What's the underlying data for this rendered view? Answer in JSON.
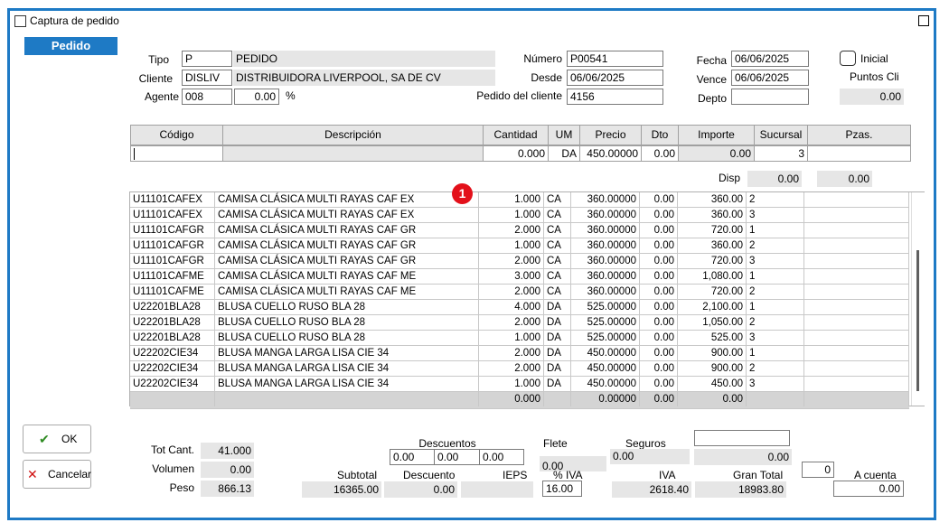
{
  "window": {
    "title": "Captura de pedido"
  },
  "section_tab": "Pedido",
  "header": {
    "tipo_label": "Tipo",
    "tipo_code": "P",
    "tipo_desc": "PEDIDO",
    "cliente_label": "Cliente",
    "cliente_code": "DISLIV",
    "cliente_name": "DISTRIBUIDORA LIVERPOOL, SA DE CV",
    "agente_label": "Agente",
    "agente_code": "008",
    "agente_pct": "0.00",
    "pct_symbol": "%",
    "numero_label": "Número",
    "numero": "P00541",
    "desde_label": "Desde",
    "desde": "06/06/2025",
    "pedido_cliente_label": "Pedido del cliente",
    "pedido_cliente": "4156",
    "fecha_label": "Fecha",
    "fecha": "06/06/2025",
    "vence_label": "Vence",
    "vence": "06/06/2025",
    "depto_label": "Depto",
    "depto": "",
    "inicial_label": "Inicial",
    "puntos_label": "Puntos Cli",
    "puntos": "0.00"
  },
  "entry": {
    "columns": [
      "Código",
      "Descripción",
      "Cantidad",
      "UM",
      "Precio",
      "Dto",
      "Importe",
      "Sucursal",
      "Pzas."
    ],
    "codigo": "",
    "descripcion": "",
    "cantidad": "0.000",
    "um": "DA",
    "precio": "450.00000",
    "dto": "0.00",
    "importe": "0.00",
    "sucursal": "3",
    "pzas": "",
    "disp_label": "Disp",
    "disp1": "0.00",
    "disp2": "0.00"
  },
  "badge": "1",
  "rows": [
    {
      "codigo": "U11101CAFEX",
      "desc": "CAMISA CLÁSICA MULTI RAYAS CAF EX",
      "cant": "1.000",
      "um": "CA",
      "precio": "360.00000",
      "dto": "0.00",
      "importe": "360.00",
      "suc": "2"
    },
    {
      "codigo": "U11101CAFEX",
      "desc": "CAMISA CLÁSICA MULTI RAYAS CAF EX",
      "cant": "1.000",
      "um": "CA",
      "precio": "360.00000",
      "dto": "0.00",
      "importe": "360.00",
      "suc": "3"
    },
    {
      "codigo": "U11101CAFGR",
      "desc": "CAMISA CLÁSICA MULTI RAYAS CAF GR",
      "cant": "2.000",
      "um": "CA",
      "precio": "360.00000",
      "dto": "0.00",
      "importe": "720.00",
      "suc": "1"
    },
    {
      "codigo": "U11101CAFGR",
      "desc": "CAMISA CLÁSICA MULTI RAYAS CAF GR",
      "cant": "1.000",
      "um": "CA",
      "precio": "360.00000",
      "dto": "0.00",
      "importe": "360.00",
      "suc": "2"
    },
    {
      "codigo": "U11101CAFGR",
      "desc": "CAMISA CLÁSICA MULTI RAYAS CAF GR",
      "cant": "2.000",
      "um": "CA",
      "precio": "360.00000",
      "dto": "0.00",
      "importe": "720.00",
      "suc": "3"
    },
    {
      "codigo": "U11101CAFME",
      "desc": "CAMISA CLÁSICA MULTI RAYAS CAF ME",
      "cant": "3.000",
      "um": "CA",
      "precio": "360.00000",
      "dto": "0.00",
      "importe": "1,080.00",
      "suc": "1"
    },
    {
      "codigo": "U11101CAFME",
      "desc": "CAMISA CLÁSICA MULTI RAYAS CAF ME",
      "cant": "2.000",
      "um": "CA",
      "precio": "360.00000",
      "dto": "0.00",
      "importe": "720.00",
      "suc": "2"
    },
    {
      "codigo": "U22201BLA28",
      "desc": "BLUSA CUELLO RUSO BLA 28",
      "cant": "4.000",
      "um": "DA",
      "precio": "525.00000",
      "dto": "0.00",
      "importe": "2,100.00",
      "suc": "1"
    },
    {
      "codigo": "U22201BLA28",
      "desc": "BLUSA CUELLO RUSO BLA 28",
      "cant": "2.000",
      "um": "DA",
      "precio": "525.00000",
      "dto": "0.00",
      "importe": "1,050.00",
      "suc": "2"
    },
    {
      "codigo": "U22201BLA28",
      "desc": "BLUSA CUELLO RUSO BLA 28",
      "cant": "1.000",
      "um": "DA",
      "precio": "525.00000",
      "dto": "0.00",
      "importe": "525.00",
      "suc": "3"
    },
    {
      "codigo": "U22202CIE34",
      "desc": "BLUSA MANGA LARGA LISA CIE 34",
      "cant": "2.000",
      "um": "DA",
      "precio": "450.00000",
      "dto": "0.00",
      "importe": "900.00",
      "suc": "1"
    },
    {
      "codigo": "U22202CIE34",
      "desc": "BLUSA MANGA LARGA LISA CIE 34",
      "cant": "2.000",
      "um": "DA",
      "precio": "450.00000",
      "dto": "0.00",
      "importe": "900.00",
      "suc": "2"
    },
    {
      "codigo": "U22202CIE34",
      "desc": "BLUSA MANGA LARGA LISA CIE 34",
      "cant": "1.000",
      "um": "DA",
      "precio": "450.00000",
      "dto": "0.00",
      "importe": "450.00",
      "suc": "3"
    },
    {
      "codigo": "",
      "desc": "",
      "cant": "0.000",
      "um": "",
      "precio": "0.00000",
      "dto": "0.00",
      "importe": "0.00",
      "suc": ""
    }
  ],
  "buttons": {
    "ok": "OK",
    "cancelar": "Cancelar"
  },
  "totals": {
    "tot_cant_label": "Tot Cant.",
    "tot_cant": "41.000",
    "volumen_label": "Volumen",
    "volumen": "0.00",
    "peso_label": "Peso",
    "peso": "866.13",
    "descuentos_label": "Descuentos",
    "desc1": "0.00",
    "desc2": "0.00",
    "desc3": "0.00",
    "flete_label": "Flete",
    "flete": "0.00",
    "seguros_label": "Seguros",
    "seguros": "0.00",
    "extra_field": "",
    "extra_value": "0.00",
    "subtotal_label": "Subtotal",
    "subtotal": "16365.00",
    "descuento_label": "Descuento",
    "descuento": "0.00",
    "ieps_label": "IEPS",
    "ieps": "",
    "pct_iva_label": "% IVA",
    "pct_iva": "16.00",
    "iva_label": "IVA",
    "iva": "2618.40",
    "gran_total_label": "Gran Total",
    "gran_total": "18983.80",
    "counter": "0",
    "a_cuenta_label": "A cuenta",
    "a_cuenta": "0.00"
  },
  "colors": {
    "accent": "#1e7ac5",
    "badge": "#e3101a",
    "ok_check": "#2e8b22",
    "cancel_x": "#d01010"
  }
}
